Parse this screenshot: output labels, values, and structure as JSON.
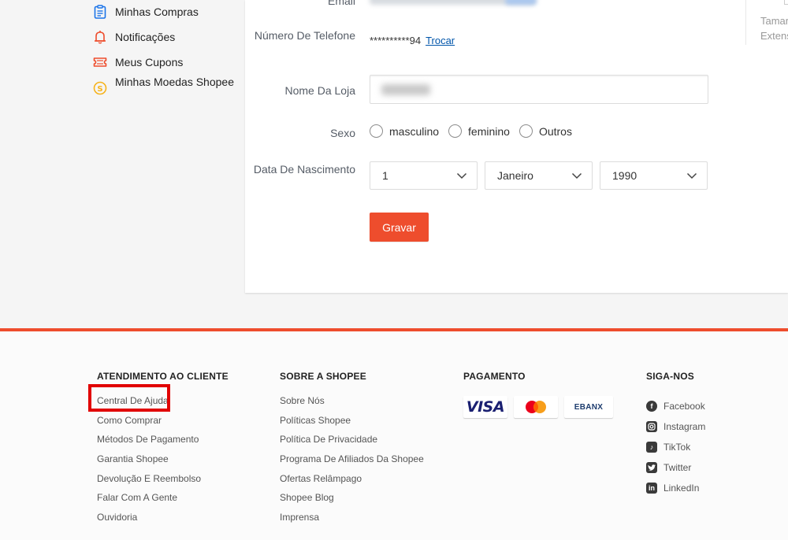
{
  "sidebar": {
    "items": [
      {
        "label": "Minhas Compras",
        "icon": "clipboard-icon"
      },
      {
        "label": "Notificações",
        "icon": "bell-icon"
      },
      {
        "label": "Meus Cupons",
        "icon": "ticket-icon"
      },
      {
        "label": "Minhas Moedas Shopee",
        "icon": "coin-icon"
      }
    ]
  },
  "form": {
    "email_label": "Email",
    "phone_label": "Número De Telefone",
    "phone_value": "**********94",
    "phone_change": "Trocar",
    "store_label": "Nome Da Loja",
    "sex_label": "Sexo",
    "sex_options": [
      "masculino",
      "feminino",
      "Outros"
    ],
    "birth_label": "Data De Nascimento",
    "birth_day": "1",
    "birth_month": "Janeiro",
    "birth_year": "1990",
    "save_label": "Gravar"
  },
  "right_panel": {
    "line1": "Tamar",
    "line2": "Extens"
  },
  "footer": {
    "customer_service": {
      "title": "ATENDIMENTO AO CLIENTE",
      "links": [
        "Central De Ajuda",
        "Como Comprar",
        "Métodos De Pagamento",
        "Garantia Shopee",
        "Devolução E Reembolso",
        "Falar Com A Gente",
        "Ouvidoria"
      ]
    },
    "about": {
      "title": "SOBRE A SHOPEE",
      "links": [
        "Sobre Nós",
        "Políticas Shopee",
        "Política De Privacidade",
        "Programa De Afiliados Da Shopee",
        "Ofertas Relâmpago",
        "Shopee Blog",
        "Imprensa"
      ]
    },
    "payment": {
      "title": "PAGAMENTO",
      "methods": [
        "VISA",
        "mastercard",
        "EBANX"
      ],
      "visa_text": "VISA",
      "ebanx_text": "EBANX"
    },
    "follow": {
      "title": "SIGA-NOS",
      "links": [
        {
          "label": "Facebook",
          "icon": "facebook-icon"
        },
        {
          "label": "Instagram",
          "icon": "instagram-icon"
        },
        {
          "label": "TikTok",
          "icon": "tiktok-icon"
        },
        {
          "label": "Twitter",
          "icon": "twitter-icon"
        },
        {
          "label": "LinkedIn",
          "icon": "linkedin-icon"
        }
      ]
    }
  },
  "colors": {
    "accent": "#ee4d2d",
    "highlight_box": "#e10000",
    "link": "#0055aa"
  }
}
